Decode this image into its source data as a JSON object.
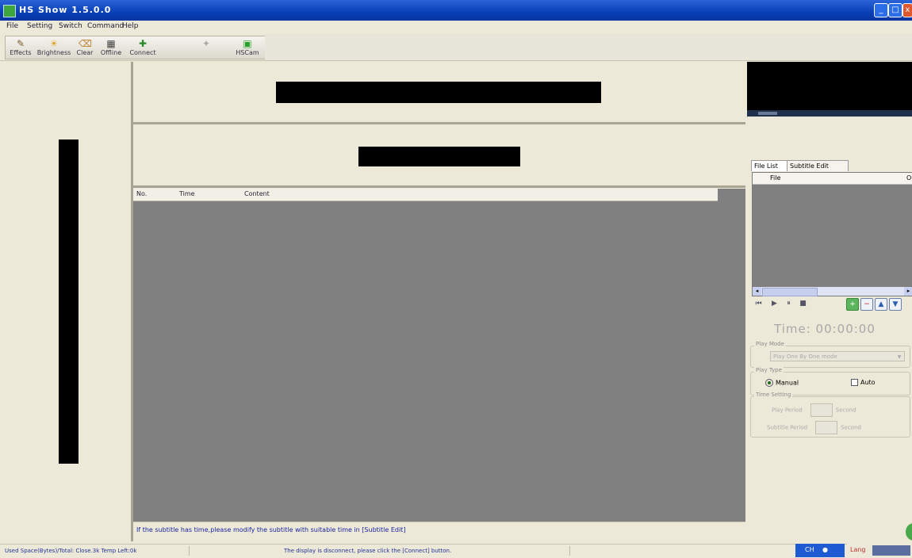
{
  "window": {
    "title": "HS Show 1.5.0.0",
    "minimize_glyph": "_",
    "maximize_glyph": "□",
    "close_glyph": "x"
  },
  "menu": [
    "File",
    "Setting",
    "Switch",
    "Command",
    "Help"
  ],
  "toolbar": [
    {
      "label": "Effects",
      "icon": "effects-icon"
    },
    {
      "label": "Brightness",
      "icon": "brightness-icon"
    },
    {
      "label": "Clear",
      "icon": "clear-icon"
    },
    {
      "label": "Offline",
      "icon": "offline-icon"
    },
    {
      "label": "Connect",
      "icon": "connect-icon"
    },
    {
      "label": "",
      "icon": "disabled-icon"
    },
    {
      "label": "HSCam",
      "icon": "hscam-icon"
    }
  ],
  "subtitle_list": {
    "columns": [
      "No.",
      "Time",
      "Content"
    ]
  },
  "hint": "If the subtitle has time,please modify the subtitle with suitable time in [Subtitle Edit]",
  "right_panel": {
    "tabs": [
      "File List",
      "Subtitle Edit"
    ],
    "file_list_columns": [
      "File",
      "Or"
    ],
    "controls": [
      "prev",
      "play",
      "pause",
      "stop"
    ],
    "side_buttons": [
      "+",
      "−",
      "▲",
      "▼"
    ],
    "timer": "Time: 00:00:00",
    "play_mode": {
      "label": "Play Mode",
      "value": "Play One By One mode"
    },
    "play_type": {
      "label": "Play Type",
      "options": [
        {
          "label": "Manual",
          "checked": true
        },
        {
          "label": "Auto",
          "checked": false
        }
      ]
    },
    "time_setting": {
      "label": "Time Setting",
      "rows": [
        {
          "label": "Play Period",
          "unit": "Second"
        },
        {
          "label": "Subtitle Period",
          "unit": "Second"
        }
      ]
    }
  },
  "status": {
    "left": "Used Space(Bytes)/Total: Close.3k Temp Left:0k",
    "right": "The display is disconnect, please click the [Connect] button.",
    "tray_lang": "CH",
    "tray_lang2": "Lang"
  }
}
